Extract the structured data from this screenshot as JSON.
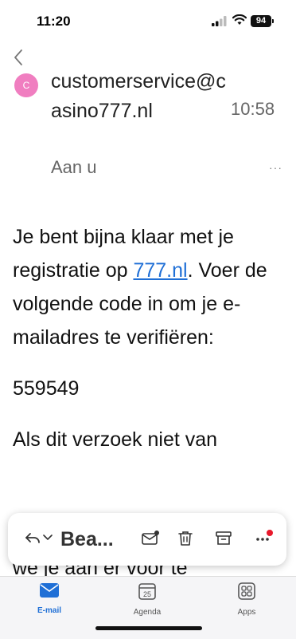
{
  "status_bar": {
    "time": "11:20",
    "battery": "94"
  },
  "email": {
    "avatar_letter": "C",
    "sender": "customerservice@casino777.nl",
    "time": "10:58",
    "recipient": "Aan u",
    "more": "···",
    "body": {
      "p1_before": "Je bent bijna klaar met je registratie op ",
      "p1_link": "777.nl",
      "p1_after": ". Voer de volgende code in om je e-mailadres te verifiëren:",
      "code": "559549",
      "p3": "Als dit verzoek niet van",
      "p4_partial": "we je aan er voor te"
    }
  },
  "toolbar": {
    "reply_label": "Bea..."
  },
  "tabs": [
    {
      "label": "E-mail",
      "icon": "mail-icon",
      "active": true
    },
    {
      "label": "Agenda",
      "icon": "calendar-icon",
      "day": "25"
    },
    {
      "label": "Apps",
      "icon": "apps-icon"
    }
  ],
  "colors": {
    "accent": "#1f6fd6",
    "avatar": "#f07ec0",
    "notification": "#e8192c"
  }
}
